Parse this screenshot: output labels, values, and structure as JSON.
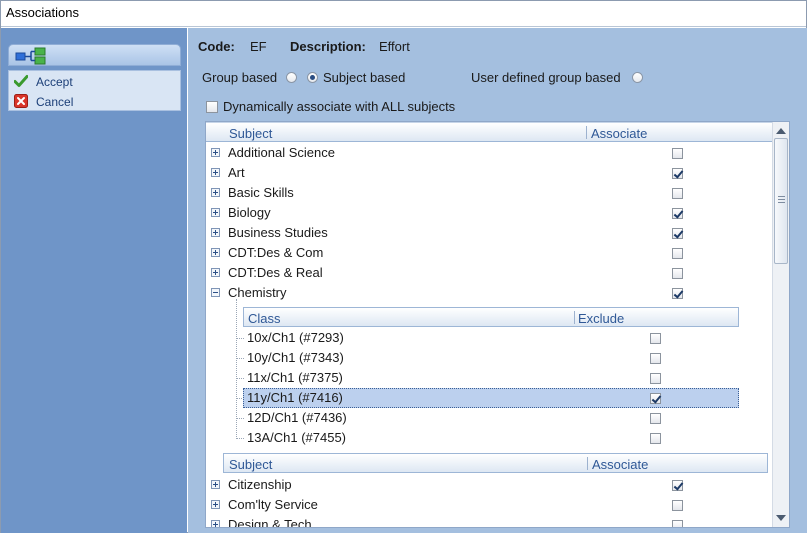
{
  "window": {
    "title": "Associations"
  },
  "sidebar": {
    "items": [
      {
        "label": "Accept",
        "icon": "checkmark-icon",
        "color": "#3a9a2e"
      },
      {
        "label": "Cancel",
        "icon": "cancel-icon",
        "color": "#d9352a"
      }
    ]
  },
  "header": {
    "code_label": "Code:",
    "code_value": "EF",
    "description_label": "Description:",
    "description_value": "Effort"
  },
  "options": {
    "group_based_label": "Group based",
    "subject_based_label": "Subject based",
    "user_defined_label": "User defined group based",
    "selected": "Subject based",
    "dynamic_label": "Dynamically associate with ALL subjects",
    "dynamic_checked": false
  },
  "grid": {
    "subject_header": {
      "col1": "Subject",
      "col2": "Associate"
    },
    "class_header": {
      "col1": "Class",
      "col2": "Exclude"
    },
    "subjects_top": [
      {
        "name": "Additional Science",
        "associate": false,
        "expanded": false
      },
      {
        "name": "Art",
        "associate": true,
        "expanded": false
      },
      {
        "name": "Basic Skills",
        "associate": false,
        "expanded": false
      },
      {
        "name": "Biology",
        "associate": true,
        "expanded": false
      },
      {
        "name": "Business Studies",
        "associate": true,
        "expanded": false
      },
      {
        "name": "CDT:Des & Com",
        "associate": false,
        "expanded": false
      },
      {
        "name": "CDT:Des & Real",
        "associate": false,
        "expanded": false
      },
      {
        "name": "Chemistry",
        "associate": true,
        "expanded": true
      }
    ],
    "classes": [
      {
        "name": "10x/Ch1 (#7293)",
        "exclude": false,
        "selected": false
      },
      {
        "name": "10y/Ch1 (#7343)",
        "exclude": false,
        "selected": false
      },
      {
        "name": "11x/Ch1 (#7375)",
        "exclude": false,
        "selected": false
      },
      {
        "name": "11y/Ch1 (#7416)",
        "exclude": true,
        "selected": true
      },
      {
        "name": "12D/Ch1 (#7436)",
        "exclude": false,
        "selected": false
      },
      {
        "name": "13A/Ch1 (#7455)",
        "exclude": false,
        "selected": false
      }
    ],
    "subjects_bottom": [
      {
        "name": "Citizenship",
        "associate": true,
        "expanded": false
      },
      {
        "name": "Com'lty Service",
        "associate": false,
        "expanded": false
      },
      {
        "name": "Design & Tech",
        "associate": false,
        "expanded": false
      }
    ]
  }
}
